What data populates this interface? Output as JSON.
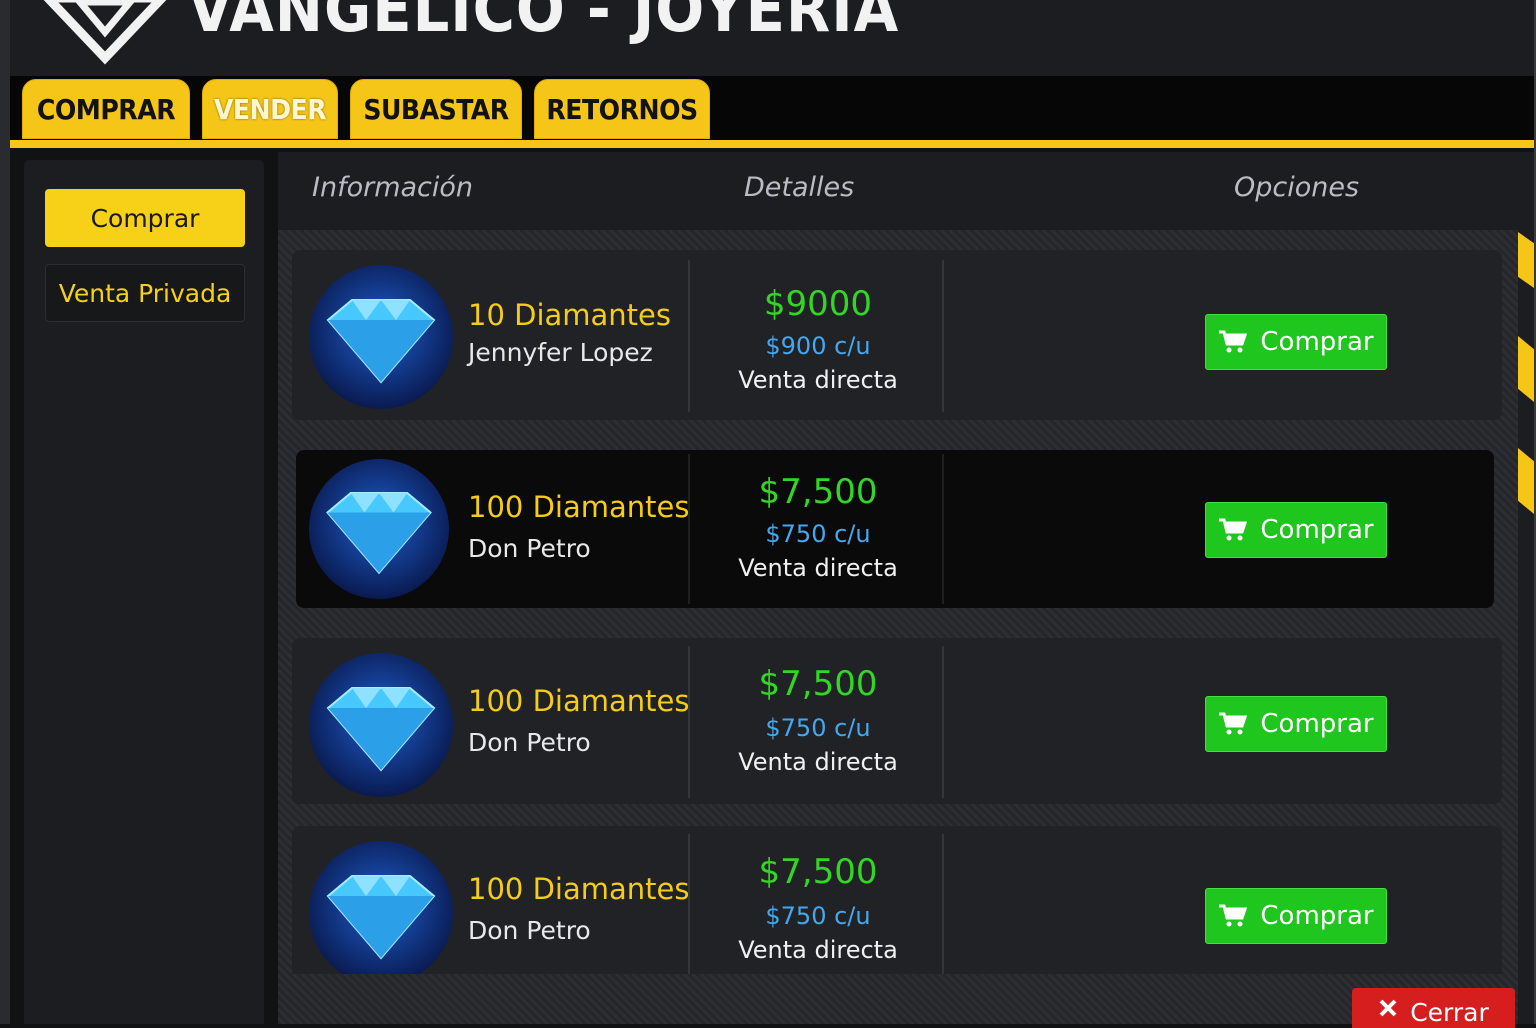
{
  "header": {
    "title": "VANGELICO - JOYERIA",
    "logo_icon": "diamond-outline-icon"
  },
  "tabs": [
    {
      "label": "COMPRAR",
      "active": false
    },
    {
      "label": "VENDER",
      "active": true
    },
    {
      "label": "SUBASTAR",
      "active": false
    },
    {
      "label": "RETORNOS",
      "active": false
    }
  ],
  "sidebar": {
    "primary_label": "Comprar",
    "secondary_label": "Venta Privada"
  },
  "columns": {
    "info": "Información",
    "details": "Detalles",
    "options": "Opciones"
  },
  "listings": [
    {
      "name": "10 Diamantes",
      "seller": "Jennyfer Lopez",
      "price": "$9000",
      "unit_price": "$900 c/u",
      "sale_type": "Venta directa",
      "button": "Comprar",
      "icon": "blue-diamond-icon",
      "highlighted": false
    },
    {
      "name": "100 Diamantes",
      "seller": "Don Petro",
      "price": "$7,500",
      "unit_price": "$750 c/u",
      "sale_type": "Venta directa",
      "button": "Comprar",
      "icon": "blue-diamond-icon",
      "highlighted": true
    },
    {
      "name": "100 Diamantes",
      "seller": "Don Petro",
      "price": "$7,500",
      "unit_price": "$750 c/u",
      "sale_type": "Venta directa",
      "button": "Comprar",
      "icon": "blue-diamond-icon",
      "highlighted": false
    },
    {
      "name": "100 Diamantes",
      "seller": "Don Petro",
      "price": "$7,500",
      "unit_price": "$750 c/u",
      "sale_type": "Venta directa",
      "button": "Comprar",
      "icon": "blue-diamond-icon",
      "highlighted": false
    }
  ],
  "close_button": {
    "label": "Cerrar",
    "icon": "x-icon"
  },
  "colors": {
    "accent": "#f5c518",
    "price": "#33d624",
    "unit": "#44a8f0",
    "buy": "#1ec61e",
    "close": "#d71e1e"
  }
}
